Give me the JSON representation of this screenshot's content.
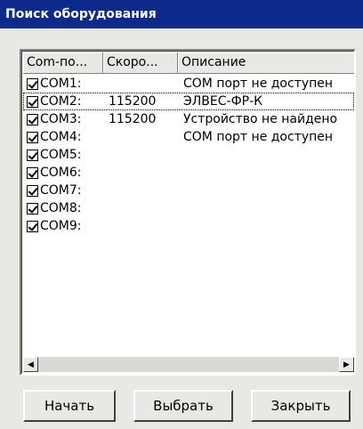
{
  "window": {
    "title": "Поиск оборудования"
  },
  "columns": [
    "Com-по...",
    "Скоро...",
    "Описание"
  ],
  "rows": [
    {
      "port": "COM1:",
      "speed": "",
      "desc": "COM порт не доступен",
      "checked": true
    },
    {
      "port": "COM2:",
      "speed": "115200",
      "desc": "ЭЛВЕС-ФР-К",
      "checked": true
    },
    {
      "port": "COM3:",
      "speed": "115200",
      "desc": "Устройство не найдено",
      "checked": true
    },
    {
      "port": "COM4:",
      "speed": "",
      "desc": "COM порт не доступен",
      "checked": true
    },
    {
      "port": "COM5:",
      "speed": "",
      "desc": "",
      "checked": true
    },
    {
      "port": "COM6:",
      "speed": "",
      "desc": "",
      "checked": true
    },
    {
      "port": "COM7:",
      "speed": "",
      "desc": "",
      "checked": true
    },
    {
      "port": "COM8:",
      "speed": "",
      "desc": "",
      "checked": true
    },
    {
      "port": "COM9:",
      "speed": "",
      "desc": "",
      "checked": true
    }
  ],
  "buttons": {
    "start": "Начать",
    "select": "Выбрать",
    "close": "Закрыть"
  }
}
